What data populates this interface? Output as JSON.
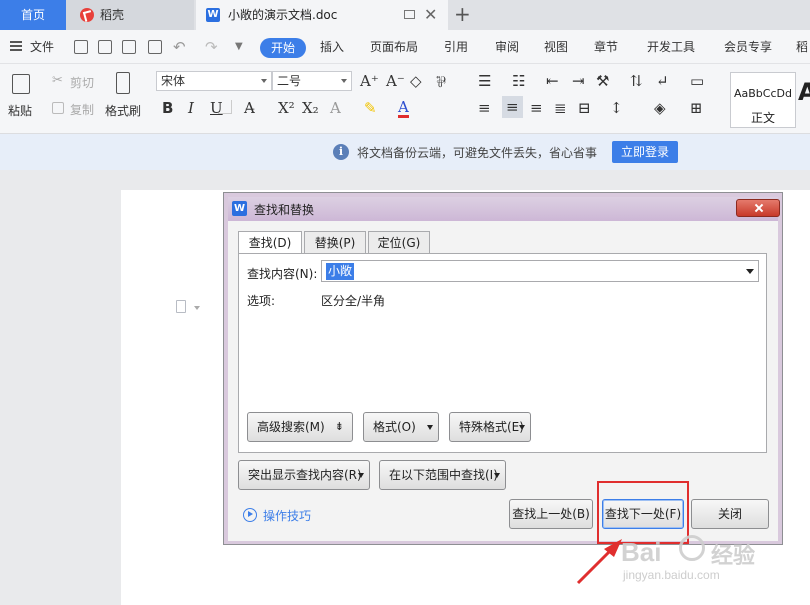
{
  "tabs": {
    "home": "首页",
    "daoke": "稻壳",
    "doc": "小敞的演示文档.doc",
    "doc_icon": "W"
  },
  "menu": {
    "file": "文件",
    "items": [
      "开始",
      "插入",
      "页面布局",
      "引用",
      "审阅",
      "视图",
      "章节",
      "开发工具",
      "会员专享",
      "稻"
    ]
  },
  "ribbon": {
    "paste": "粘贴",
    "cut": "剪切",
    "copy": "复制",
    "format_painter": "格式刷",
    "font_name": "宋体",
    "font_size": "二号",
    "style_sample": "AaBbCcDd",
    "style_name": "正文",
    "big_a": "A"
  },
  "banner": {
    "text": "将文档备份云端，可避免文件丢失，省心省事",
    "login": "立即登录"
  },
  "dialog": {
    "title": "查找和替换",
    "icon": "W",
    "tabs": [
      "查找(D)",
      "替换(P)",
      "定位(G)"
    ],
    "find_label": "查找内容(N):",
    "find_value": "小敞",
    "options_label": "选项:",
    "options_value": "区分全/半角",
    "advanced_search": "高级搜索(M)",
    "advanced_search_marker": "⇟",
    "format": "格式(O)",
    "special_format": "特殊格式(E)",
    "highlight": "突出显示查找内容(R)",
    "find_in": "在以下范围中查找(I)",
    "tips": "操作技巧",
    "find_prev": "查找上一处(B)",
    "find_next": "查找下一处(F)",
    "close": "关闭"
  },
  "watermark": {
    "brand_left": "Bai",
    "brand_right": "经验",
    "url": "jingyan.baidu.com"
  },
  "colors": {
    "accent": "#3c7ee8",
    "highlight_box": "#e02e2e"
  }
}
